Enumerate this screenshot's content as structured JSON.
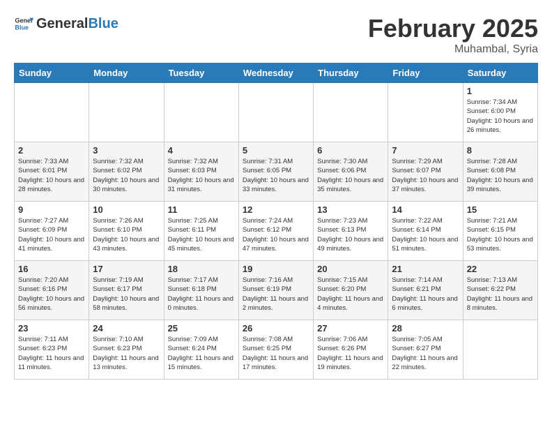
{
  "header": {
    "logo_general": "General",
    "logo_blue": "Blue",
    "month_title": "February 2025",
    "location": "Muhambal, Syria"
  },
  "days_of_week": [
    "Sunday",
    "Monday",
    "Tuesday",
    "Wednesday",
    "Thursday",
    "Friday",
    "Saturday"
  ],
  "weeks": [
    [
      {
        "day": "",
        "info": ""
      },
      {
        "day": "",
        "info": ""
      },
      {
        "day": "",
        "info": ""
      },
      {
        "day": "",
        "info": ""
      },
      {
        "day": "",
        "info": ""
      },
      {
        "day": "",
        "info": ""
      },
      {
        "day": "1",
        "info": "Sunrise: 7:34 AM\nSunset: 6:00 PM\nDaylight: 10 hours and 26 minutes."
      }
    ],
    [
      {
        "day": "2",
        "info": "Sunrise: 7:33 AM\nSunset: 6:01 PM\nDaylight: 10 hours and 28 minutes."
      },
      {
        "day": "3",
        "info": "Sunrise: 7:32 AM\nSunset: 6:02 PM\nDaylight: 10 hours and 30 minutes."
      },
      {
        "day": "4",
        "info": "Sunrise: 7:32 AM\nSunset: 6:03 PM\nDaylight: 10 hours and 31 minutes."
      },
      {
        "day": "5",
        "info": "Sunrise: 7:31 AM\nSunset: 6:05 PM\nDaylight: 10 hours and 33 minutes."
      },
      {
        "day": "6",
        "info": "Sunrise: 7:30 AM\nSunset: 6:06 PM\nDaylight: 10 hours and 35 minutes."
      },
      {
        "day": "7",
        "info": "Sunrise: 7:29 AM\nSunset: 6:07 PM\nDaylight: 10 hours and 37 minutes."
      },
      {
        "day": "8",
        "info": "Sunrise: 7:28 AM\nSunset: 6:08 PM\nDaylight: 10 hours and 39 minutes."
      }
    ],
    [
      {
        "day": "9",
        "info": "Sunrise: 7:27 AM\nSunset: 6:09 PM\nDaylight: 10 hours and 41 minutes."
      },
      {
        "day": "10",
        "info": "Sunrise: 7:26 AM\nSunset: 6:10 PM\nDaylight: 10 hours and 43 minutes."
      },
      {
        "day": "11",
        "info": "Sunrise: 7:25 AM\nSunset: 6:11 PM\nDaylight: 10 hours and 45 minutes."
      },
      {
        "day": "12",
        "info": "Sunrise: 7:24 AM\nSunset: 6:12 PM\nDaylight: 10 hours and 47 minutes."
      },
      {
        "day": "13",
        "info": "Sunrise: 7:23 AM\nSunset: 6:13 PM\nDaylight: 10 hours and 49 minutes."
      },
      {
        "day": "14",
        "info": "Sunrise: 7:22 AM\nSunset: 6:14 PM\nDaylight: 10 hours and 51 minutes."
      },
      {
        "day": "15",
        "info": "Sunrise: 7:21 AM\nSunset: 6:15 PM\nDaylight: 10 hours and 53 minutes."
      }
    ],
    [
      {
        "day": "16",
        "info": "Sunrise: 7:20 AM\nSunset: 6:16 PM\nDaylight: 10 hours and 56 minutes."
      },
      {
        "day": "17",
        "info": "Sunrise: 7:19 AM\nSunset: 6:17 PM\nDaylight: 10 hours and 58 minutes."
      },
      {
        "day": "18",
        "info": "Sunrise: 7:17 AM\nSunset: 6:18 PM\nDaylight: 11 hours and 0 minutes."
      },
      {
        "day": "19",
        "info": "Sunrise: 7:16 AM\nSunset: 6:19 PM\nDaylight: 11 hours and 2 minutes."
      },
      {
        "day": "20",
        "info": "Sunrise: 7:15 AM\nSunset: 6:20 PM\nDaylight: 11 hours and 4 minutes."
      },
      {
        "day": "21",
        "info": "Sunrise: 7:14 AM\nSunset: 6:21 PM\nDaylight: 11 hours and 6 minutes."
      },
      {
        "day": "22",
        "info": "Sunrise: 7:13 AM\nSunset: 6:22 PM\nDaylight: 11 hours and 8 minutes."
      }
    ],
    [
      {
        "day": "23",
        "info": "Sunrise: 7:11 AM\nSunset: 6:23 PM\nDaylight: 11 hours and 11 minutes."
      },
      {
        "day": "24",
        "info": "Sunrise: 7:10 AM\nSunset: 6:23 PM\nDaylight: 11 hours and 13 minutes."
      },
      {
        "day": "25",
        "info": "Sunrise: 7:09 AM\nSunset: 6:24 PM\nDaylight: 11 hours and 15 minutes."
      },
      {
        "day": "26",
        "info": "Sunrise: 7:08 AM\nSunset: 6:25 PM\nDaylight: 11 hours and 17 minutes."
      },
      {
        "day": "27",
        "info": "Sunrise: 7:06 AM\nSunset: 6:26 PM\nDaylight: 11 hours and 19 minutes."
      },
      {
        "day": "28",
        "info": "Sunrise: 7:05 AM\nSunset: 6:27 PM\nDaylight: 11 hours and 22 minutes."
      },
      {
        "day": "",
        "info": ""
      }
    ]
  ]
}
